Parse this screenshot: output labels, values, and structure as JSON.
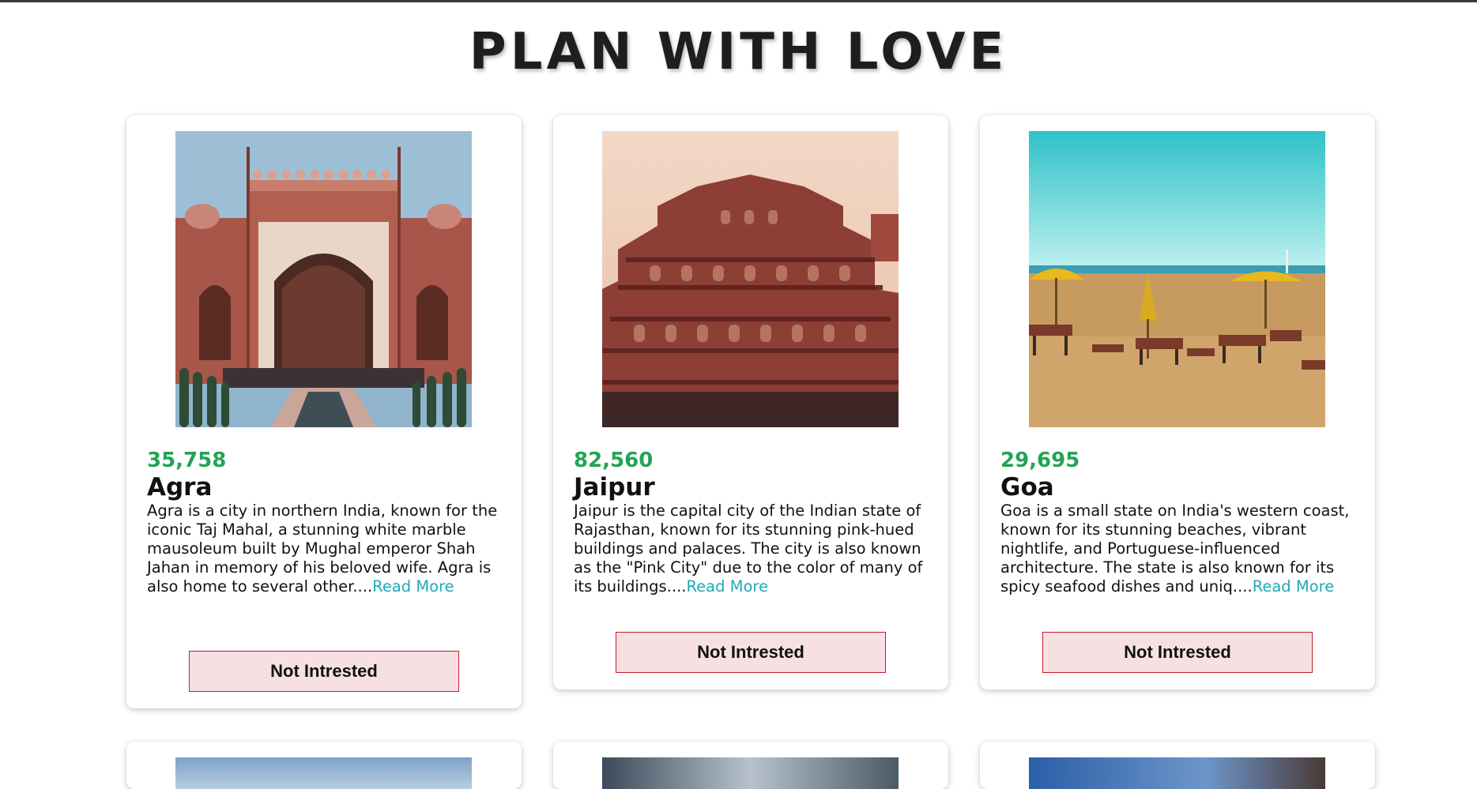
{
  "page": {
    "title": "PLAN WITH LOVE",
    "accent_price_color": "#22a455",
    "link_color": "#1fa8b8",
    "button_bg": "#f6e0e1",
    "button_border": "#c41b2a"
  },
  "tours": [
    {
      "price": "35,758",
      "city": "Agra",
      "description": "Agra is a city in northern India, known for the iconic Taj Mahal, a stunning white marble mausoleum built by Mughal emperor Shah Jahan in memory of his beloved wife. Agra is also home to several other....",
      "read_more": "Read More",
      "button_label": "Not Intrested"
    },
    {
      "price": "82,560",
      "city": "Jaipur",
      "description": "Jaipur is the capital city of the Indian state of Rajasthan, known for its stunning pink-hued buildings and palaces. The city is also known as the \"Pink City\" due to the color of many of its buildings....",
      "read_more": "Read More",
      "button_label": "Not Intrested"
    },
    {
      "price": "29,695",
      "city": "Goa",
      "description": "Goa is a small state on India's western coast, known for its stunning beaches, vibrant nightlife, and Portuguese-influenced architecture. The state is also known for its spicy seafood dishes and uniq....",
      "read_more": "Read More",
      "button_label": "Not Intrested"
    }
  ]
}
